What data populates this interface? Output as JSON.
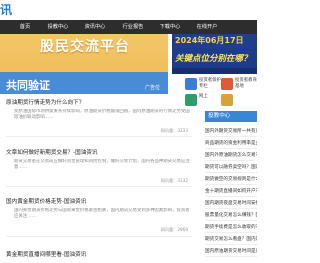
{
  "site": {
    "logo_text": "讯"
  },
  "nav": [
    "首页",
    "投教中心",
    "资讯中心",
    "行业报告",
    "下载中心",
    "在线开户"
  ],
  "banner_left": {
    "line1": "股民交流平台",
    "line2": "",
    "line3": "共同验证",
    "watermark": "广告位"
  },
  "banner_right": {
    "date": "2024年06月17日",
    "slogan": "关键点位分别在哪？"
  },
  "cards": [
    {
      "label": "投资者保护",
      "sub": "专栏",
      "color": "#3b7fd4"
    },
    {
      "label": "投资者教育",
      "sub": "基地",
      "color": "#e05a3a"
    },
    {
      "label": "网上",
      "sub": "",
      "color": "#2f9d6b"
    },
    {
      "label": "",
      "sub": "",
      "color": "#d8a23b"
    }
  ],
  "articles": [
    {
      "title": "原油期货行情走势为什么向下？",
      "desc": "受原油国际市场供需关系持续影响，原油期货价格震荡回落，国内原油期货的行情走势受国际油价联动影响……",
      "source": "网讯量：3233"
    },
    {
      "title": "文章如何做好新期货交易？-国油资讯",
      "desc": "期货交易者在交易前应做好资金管理和风险控制，做好交易计划，国内各品种期货交易应注意……",
      "source": "网讯量：3132"
    },
    {
      "title": "国内黄金期货价格走势-国油资讯",
      "desc": "国内黄金期货价格走势与国际黄金价格紧密相关，国内期货交易受到多种因素影响，投资者应关注……",
      "source": "网讯量：2869"
    },
    {
      "title": "黄金期货直播间哪里看-国油资讯",
      "desc": "",
      "source": ""
    }
  ],
  "sidebar": {
    "title": "投教中心",
    "items": [
      "国内外期货交易所一共有几家？国内",
      "商品期货的资金利用率是多少？国内",
      "国内外原油期货怎么交易？盘面如何看？",
      "期货可以融券卖空吗？国内外",
      "期货做空的交易规则是什么？国内外",
      "金十期货直播间如何开户？国内外",
      "国内期货夜盘交易时间安排？国内外",
      "股票量化交易怎么赚钱？国内外",
      "期货手续费是怎么收取的？国内外",
      "期货交易怎么看盘？国内外",
      "国内原油期货交易时间是几点？国内",
      "期货开户需要什么条件？国内外"
    ]
  }
}
